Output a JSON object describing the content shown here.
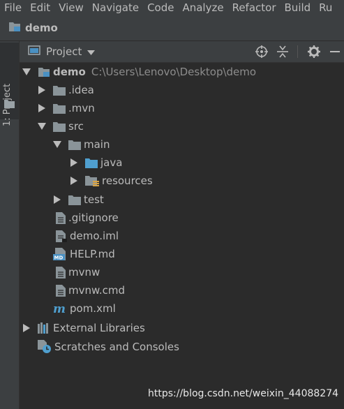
{
  "menu": [
    "File",
    "Edit",
    "View",
    "Navigate",
    "Code",
    "Analyze",
    "Refactor",
    "Build",
    "Ru"
  ],
  "navbar": {
    "project_name": "demo"
  },
  "left_strip": {
    "tab_label": "1: Project"
  },
  "tool_window": {
    "view_name": "Project",
    "actions": [
      "locate-icon",
      "collapse-icon",
      "gear-icon",
      "minimize-icon"
    ]
  },
  "tree": {
    "root": {
      "name": "demo",
      "path": "C:\\Users\\Lenovo\\Desktop\\demo"
    },
    "idea": ".idea",
    "mvn": ".mvn",
    "src": "src",
    "main": "main",
    "java": "java",
    "resources": "resources",
    "test": "test",
    "gitignore": ".gitignore",
    "demo_iml": "demo.iml",
    "help_md": "HELP.md",
    "mvnw": "mvnw",
    "mvnw_cmd": "mvnw.cmd",
    "pom_xml": "pom.xml",
    "external_libraries": "External Libraries",
    "scratches": "Scratches and Consoles"
  },
  "colors": {
    "folder": "#8a9499",
    "source_folder": "#4f9fcf",
    "module_blue": "#4a90c2",
    "background": "#2b2b2b"
  },
  "watermark": "https://blog.csdn.net/weixin_44088274"
}
